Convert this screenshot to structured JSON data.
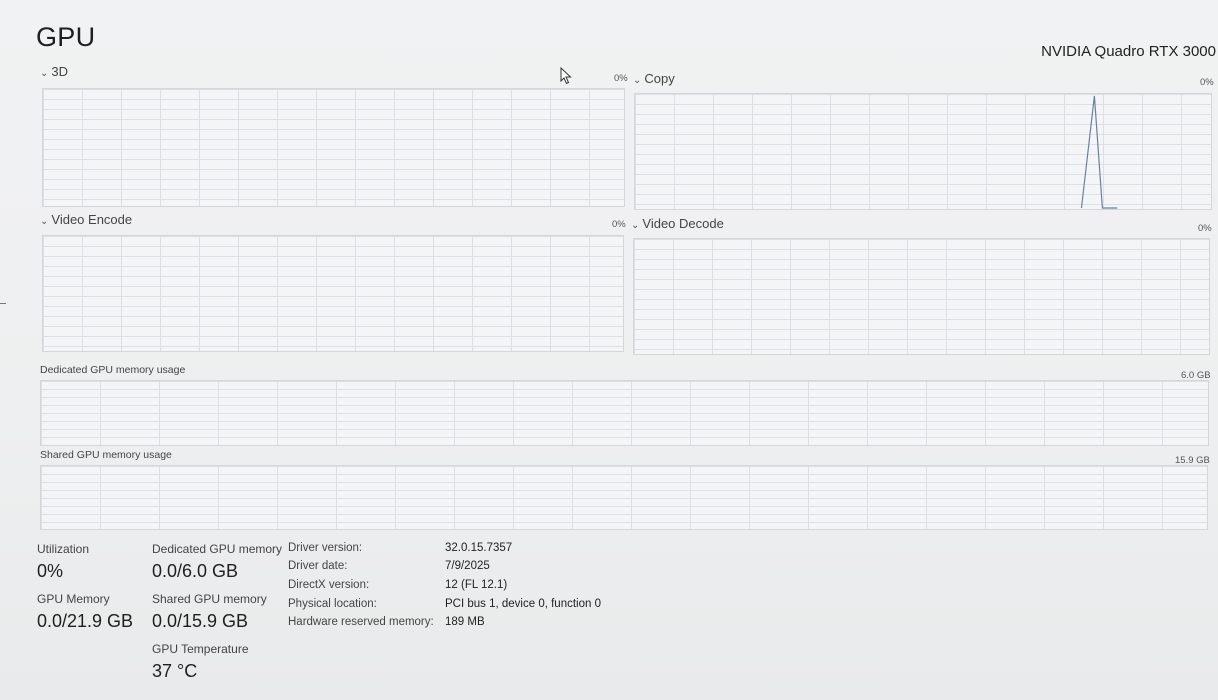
{
  "header": {
    "title": "GPU",
    "gpu_name": "NVIDIA Quadro RTX 3000"
  },
  "graphs": {
    "threed": {
      "label": "3D",
      "value": "0%"
    },
    "copy": {
      "label": "Copy",
      "value": "0%"
    },
    "video_encode": {
      "label": "Video Encode",
      "value": "0%"
    },
    "video_decode": {
      "label": "Video Decode",
      "value": "0%"
    }
  },
  "memory_graphs": {
    "dedicated": {
      "label": "Dedicated GPU memory usage",
      "max": "6.0 GB"
    },
    "shared": {
      "label": "Shared GPU memory usage",
      "max": "15.9 GB"
    }
  },
  "stats": {
    "utilization": {
      "label": "Utilization",
      "value": "0%"
    },
    "dedicated_memory": {
      "label": "Dedicated GPU memory",
      "value": "0.0/6.0 GB"
    },
    "gpu_memory": {
      "label": "GPU Memory",
      "value": "0.0/21.9 GB"
    },
    "shared_memory": {
      "label": "Shared GPU memory",
      "value": "0.0/15.9 GB"
    },
    "temperature": {
      "label": "GPU Temperature",
      "value": "37 °C"
    }
  },
  "info": {
    "driver_version": {
      "label": "Driver version:",
      "value": "32.0.15.7357"
    },
    "driver_date": {
      "label": "Driver date:",
      "value": "7/9/2025"
    },
    "directx_version": {
      "label": "DirectX version:",
      "value": "12 (FL 12.1)"
    },
    "physical_location": {
      "label": "Physical location:",
      "value": "PCI bus 1, device 0, function 0"
    },
    "hw_reserved": {
      "label": "Hardware reserved memory:",
      "value": "189 MB"
    }
  },
  "colors": {
    "line": "#6b7fa6",
    "grid": "#dde0e2",
    "border": "#d4d6d8"
  },
  "icons": {
    "chevron": "chevron-down-icon",
    "cursor": "mouse-pointer-icon"
  }
}
